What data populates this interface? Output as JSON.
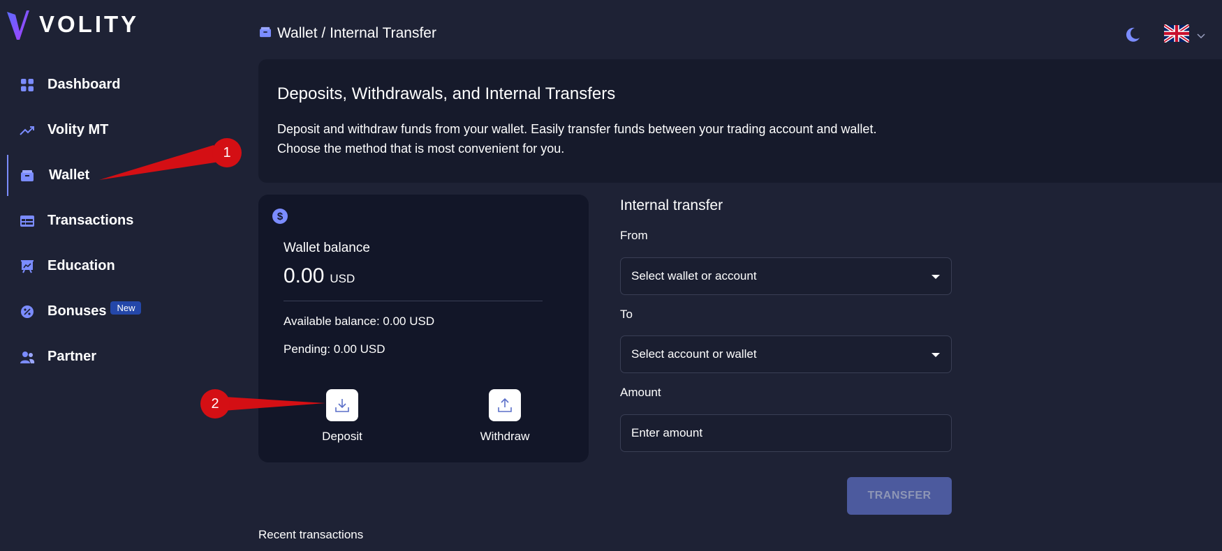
{
  "app": {
    "logo_text": "VOLITY",
    "logo_icon": "volity-v-logo"
  },
  "sidebar": {
    "items": [
      {
        "label": "Dashboard",
        "icon": "grid-icon"
      },
      {
        "label": "Volity MT",
        "icon": "trend-up-icon"
      },
      {
        "label": "Wallet",
        "icon": "wallet-icon",
        "active": true
      },
      {
        "label": "Transactions",
        "icon": "table-icon"
      },
      {
        "label": "Education",
        "icon": "presentation-icon"
      },
      {
        "label": "Bonuses",
        "icon": "percent-badge-icon",
        "badge": "New"
      },
      {
        "label": "Partner",
        "icon": "users-icon"
      }
    ]
  },
  "header": {
    "breadcrumb": "Wallet / Internal Transfer",
    "theme_icon": "moon-icon",
    "language_flag": "uk-flag-icon"
  },
  "intro": {
    "title": "Deposits, Withdrawals, and Internal Transfers",
    "line1": "Deposit and withdraw funds from your wallet. Easily transfer funds between your trading account and wallet.",
    "line2": "Choose the method that is most convenient for you."
  },
  "wallet": {
    "label": "Wallet balance",
    "amount": "0.00",
    "currency": "USD",
    "available": "Available balance: 0.00 USD",
    "pending": "Pending: 0.00 USD",
    "deposit_label": "Deposit",
    "withdraw_label": "Withdraw"
  },
  "transfer": {
    "title": "Internal transfer",
    "from_label": "From",
    "from_value": "Select wallet or account",
    "to_label": "To",
    "to_value": "Select account or wallet",
    "amount_label": "Amount",
    "amount_placeholder": "Enter amount",
    "button_label": "TRANSFER"
  },
  "recent": {
    "title": "Recent transactions"
  },
  "annotations": {
    "callout1": "1",
    "callout2": "2",
    "color": "#d40f14"
  },
  "colors": {
    "background": "#1e2235",
    "panel": "#161a2b",
    "card": "#121628",
    "accent": "#7b8cff",
    "badge": "#2447a9"
  }
}
